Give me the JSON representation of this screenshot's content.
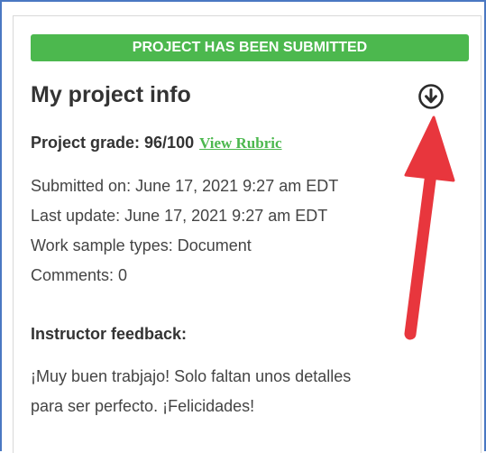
{
  "banner": {
    "text": "PROJECT HAS BEEN SUBMITTED",
    "color": "#4cb84e"
  },
  "project": {
    "title": "My project info",
    "download_icon": "download-circle-icon",
    "grade_label": "Project grade: 96/100",
    "rubric_link": "View Rubric",
    "submitted_on": "Submitted on: June 17, 2021 9:27 am EDT",
    "last_update": "Last update: June 17, 2021 9:27 am EDT",
    "work_sample_types": "Work sample types: Document",
    "comments": "Comments: 0"
  },
  "feedback": {
    "label": "Instructor feedback:",
    "line1": "¡Muy buen trabjajo! Solo faltan unos detalles",
    "line2": "para ser perfecto.  ¡Felicidades!"
  },
  "annotation": {
    "arrow_color": "#e8363d"
  }
}
